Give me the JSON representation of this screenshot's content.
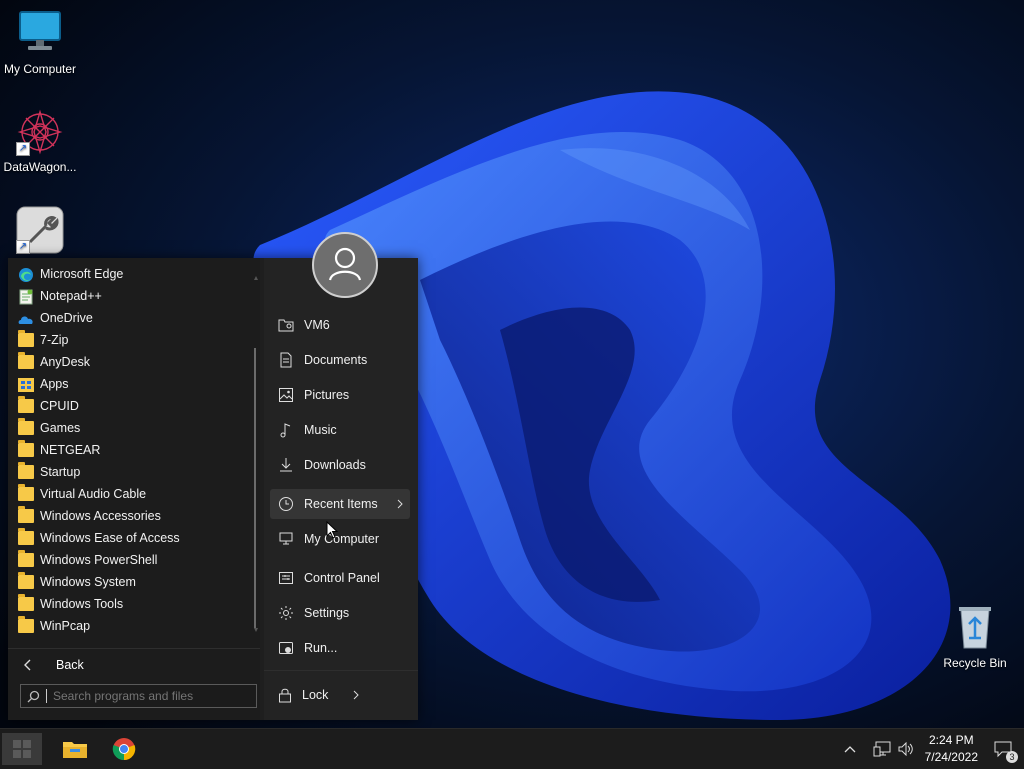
{
  "desktop": {
    "icons": [
      {
        "label": "My Computer",
        "icon": "monitor-icon"
      },
      {
        "label": "DataWagon...",
        "icon": "datawagon-icon"
      },
      {
        "label": "",
        "icon": "tools-wrench-icon"
      },
      {
        "label": "Recycle Bin",
        "icon": "recycle-bin-icon"
      }
    ]
  },
  "start_menu": {
    "programs": [
      {
        "label": "Microsoft Edge",
        "icon": "edge-icon"
      },
      {
        "label": "Notepad++",
        "icon": "notepadpp-icon"
      },
      {
        "label": "OneDrive",
        "icon": "onedrive-icon"
      },
      {
        "label": "7-Zip",
        "icon": "folder-icon"
      },
      {
        "label": "AnyDesk",
        "icon": "folder-icon"
      },
      {
        "label": "Apps",
        "icon": "apps-icon"
      },
      {
        "label": "CPUID",
        "icon": "folder-icon"
      },
      {
        "label": "Games",
        "icon": "folder-icon"
      },
      {
        "label": "NETGEAR",
        "icon": "folder-icon"
      },
      {
        "label": "Startup",
        "icon": "folder-icon"
      },
      {
        "label": "Virtual Audio Cable",
        "icon": "folder-icon"
      },
      {
        "label": "Windows Accessories",
        "icon": "folder-icon"
      },
      {
        "label": "Windows Ease of Access",
        "icon": "folder-icon"
      },
      {
        "label": "Windows PowerShell",
        "icon": "folder-icon"
      },
      {
        "label": "Windows System",
        "icon": "folder-icon"
      },
      {
        "label": "Windows Tools",
        "icon": "folder-icon"
      },
      {
        "label": "WinPcap",
        "icon": "folder-icon"
      }
    ],
    "back_label": "Back",
    "search_placeholder": "Search programs and files",
    "right_items": [
      {
        "label": "VM6",
        "icon": "user-folder-icon"
      },
      {
        "label": "Documents",
        "icon": "document-icon"
      },
      {
        "label": "Pictures",
        "icon": "picture-icon"
      },
      {
        "label": "Music",
        "icon": "music-icon"
      },
      {
        "label": "Downloads",
        "icon": "download-icon"
      },
      {
        "label": "Recent Items",
        "icon": "clock-icon"
      },
      {
        "label": "My Computer",
        "icon": "computer-icon"
      },
      {
        "label": "Control Panel",
        "icon": "control-panel-icon"
      },
      {
        "label": "Settings",
        "icon": "gear-icon"
      },
      {
        "label": "Run...",
        "icon": "run-icon"
      }
    ],
    "lock_label": "Lock"
  },
  "taskbar": {
    "time": "2:24 PM",
    "date": "7/24/2022",
    "notification_count": "3"
  },
  "colors": {
    "accent": "#1f5fff",
    "folder": "#f7c948",
    "menu_bg": "#1f1f1f"
  }
}
